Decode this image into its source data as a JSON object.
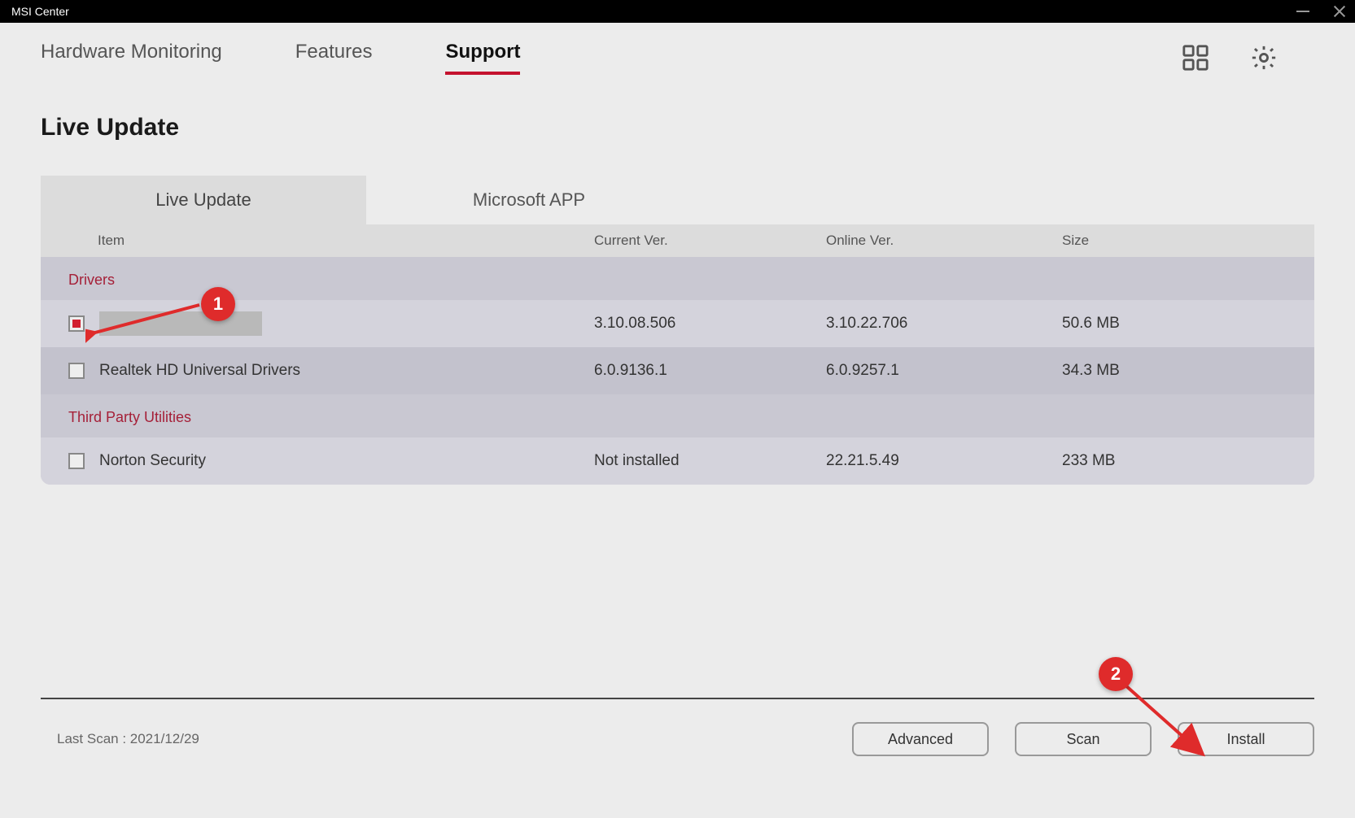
{
  "titlebar": {
    "title": "MSI Center"
  },
  "nav": {
    "tabs": [
      "Hardware Monitoring",
      "Features",
      "Support"
    ],
    "active_index": 2
  },
  "page": {
    "title": "Live Update"
  },
  "subtabs": {
    "labels": [
      "Live Update",
      "Microsoft APP"
    ],
    "active_index": 0
  },
  "columns": {
    "item": "Item",
    "current": "Current Ver.",
    "online": "Online Ver.",
    "size": "Size"
  },
  "groups": [
    {
      "name": "Drivers",
      "rows": [
        {
          "checked": true,
          "name_redacted": true,
          "name": "",
          "current": "3.10.08.506",
          "online": "3.10.22.706",
          "size": "50.6 MB"
        },
        {
          "checked": false,
          "name_redacted": false,
          "name": "Realtek HD Universal Drivers",
          "current": "6.0.9136.1",
          "online": "6.0.9257.1",
          "size": "34.3 MB"
        }
      ]
    },
    {
      "name": "Third Party Utilities",
      "rows": [
        {
          "checked": false,
          "name_redacted": false,
          "name": "Norton Security",
          "current": "Not installed",
          "online": "22.21.5.49",
          "size": "233 MB"
        }
      ]
    }
  ],
  "footer": {
    "last_scan_label": "Last Scan : 2021/12/29",
    "buttons": {
      "advanced": "Advanced",
      "scan": "Scan",
      "install": "Install"
    }
  },
  "annotations": {
    "one": "1",
    "two": "2"
  }
}
